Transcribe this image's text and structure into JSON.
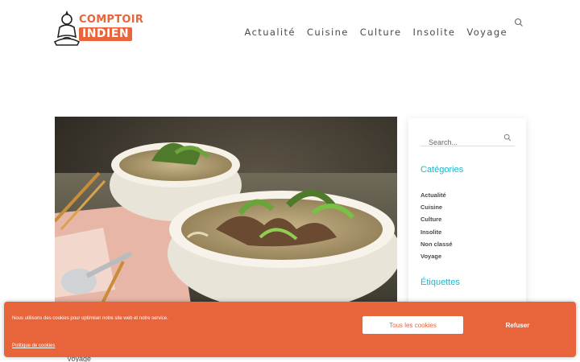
{
  "brand": {
    "line1": "COMPTOIR",
    "line2": "INDIEN",
    "accent": "#e8643a"
  },
  "nav": {
    "items": [
      "Actualité",
      "Cuisine",
      "Culture",
      "Insolite",
      "Voyage"
    ]
  },
  "header_search_icon": "search-icon",
  "post": {
    "category": "Voyage"
  },
  "sidebar": {
    "search_placeholder": "Search...",
    "categories_title": "Catégories",
    "categories": [
      "Actualité",
      "Cuisine",
      "Culture",
      "Insolite",
      "Non classé",
      "Voyage"
    ],
    "tags_title": "Étiquettes",
    "heading_color": "#1fb6c9"
  },
  "cookie": {
    "message": "Nous utilisons des cookies pour optimiser notre site web et notre service.",
    "accept": "Tous les cookies",
    "refuse": "Refuser",
    "policy": "Politique de cookies"
  }
}
